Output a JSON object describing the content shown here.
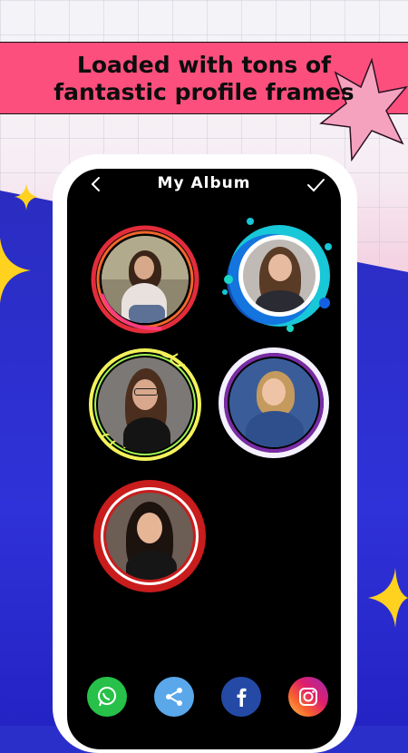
{
  "banner": {
    "line1": "Loaded with tons of",
    "line2": "fantastic profile frames"
  },
  "app": {
    "title": "My Album",
    "back_icon": "chevron-left-icon",
    "confirm_icon": "checkmark-icon"
  },
  "frames": [
    {
      "style": "red-orange-brush-ring",
      "photo": "girl-sitting-outdoors"
    },
    {
      "style": "cyan-blue-bubble-splash",
      "photo": "girl-smiling-long-hair"
    },
    {
      "style": "neon-yellow-leaf-ring",
      "photo": "girl-with-glasses"
    },
    {
      "style": "purple-white-glow-ring",
      "photo": "girl-denim-jacket"
    },
    {
      "style": "red-scalloped-badge",
      "photo": "girl-dark-hair"
    }
  ],
  "share_buttons": [
    {
      "icon": "whatsapp-icon",
      "color": "#27c14a"
    },
    {
      "icon": "share-icon",
      "color": "#5aa7ea"
    },
    {
      "icon": "facebook-icon",
      "color": "#244aa6"
    },
    {
      "icon": "instagram-icon",
      "color": "#e01e6c"
    }
  ],
  "colors": {
    "banner": "#fc4f7d",
    "background_blue": "#2b2fc9",
    "sparkle_yellow": "#ffd21f"
  }
}
